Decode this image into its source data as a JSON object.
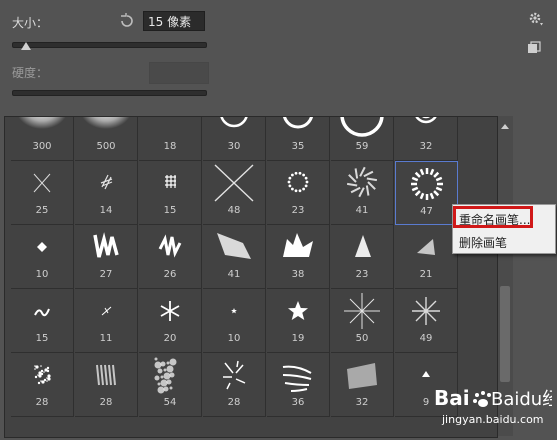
{
  "panel": {
    "size_label": "大小：",
    "size_value": "15 像素",
    "size_slider_fraction": 0.07,
    "hardness_label": "硬度："
  },
  "brushes": [
    {
      "num": "300",
      "shape": "soft-big"
    },
    {
      "num": "500",
      "shape": "soft-big"
    },
    {
      "num": "18",
      "shape": "ring-s"
    },
    {
      "num": "30",
      "shape": "ring-m"
    },
    {
      "num": "35",
      "shape": "ring-m2"
    },
    {
      "num": "59",
      "shape": "ring-l"
    },
    {
      "num": "32",
      "shape": "ring-double"
    },
    {
      "num": "25",
      "shape": "cross"
    },
    {
      "num": "14",
      "shape": "hash"
    },
    {
      "num": "15",
      "shape": "grid"
    },
    {
      "num": "48",
      "shape": "cross-big"
    },
    {
      "num": "23",
      "shape": "dot-ring"
    },
    {
      "num": "41",
      "shape": "swirl"
    },
    {
      "num": "47",
      "shape": "dash-ring"
    },
    {
      "num": "10",
      "shape": "diamond"
    },
    {
      "num": "27",
      "shape": "zigzag"
    },
    {
      "num": "26",
      "shape": "zigzag2"
    },
    {
      "num": "41",
      "shape": "chalk"
    },
    {
      "num": "38",
      "shape": "splat"
    },
    {
      "num": "23",
      "shape": "tri"
    },
    {
      "num": "21",
      "shape": "wedge"
    },
    {
      "num": "15",
      "shape": "squiggle"
    },
    {
      "num": "11",
      "shape": "tiny-cross"
    },
    {
      "num": "20",
      "shape": "snowflake"
    },
    {
      "num": "10",
      "shape": "star-s"
    },
    {
      "num": "19",
      "shape": "star-m"
    },
    {
      "num": "50",
      "shape": "sparkle"
    },
    {
      "num": "49",
      "shape": "sparkle2"
    },
    {
      "num": "28",
      "shape": "spray"
    },
    {
      "num": "28",
      "shape": "spray2"
    },
    {
      "num": "54",
      "shape": "texture"
    },
    {
      "num": "28",
      "shape": "grass"
    },
    {
      "num": "36",
      "shape": "leaves"
    },
    {
      "num": "32",
      "shape": "streak"
    },
    {
      "num": "9",
      "shape": "tri-s"
    }
  ],
  "selected_index": 13,
  "context_menu": {
    "rename_label": "重命名画笔...",
    "delete_label": "删除画笔"
  },
  "watermark": {
    "brand": "Baidu经验",
    "url": "jingyan.baidu.com"
  }
}
